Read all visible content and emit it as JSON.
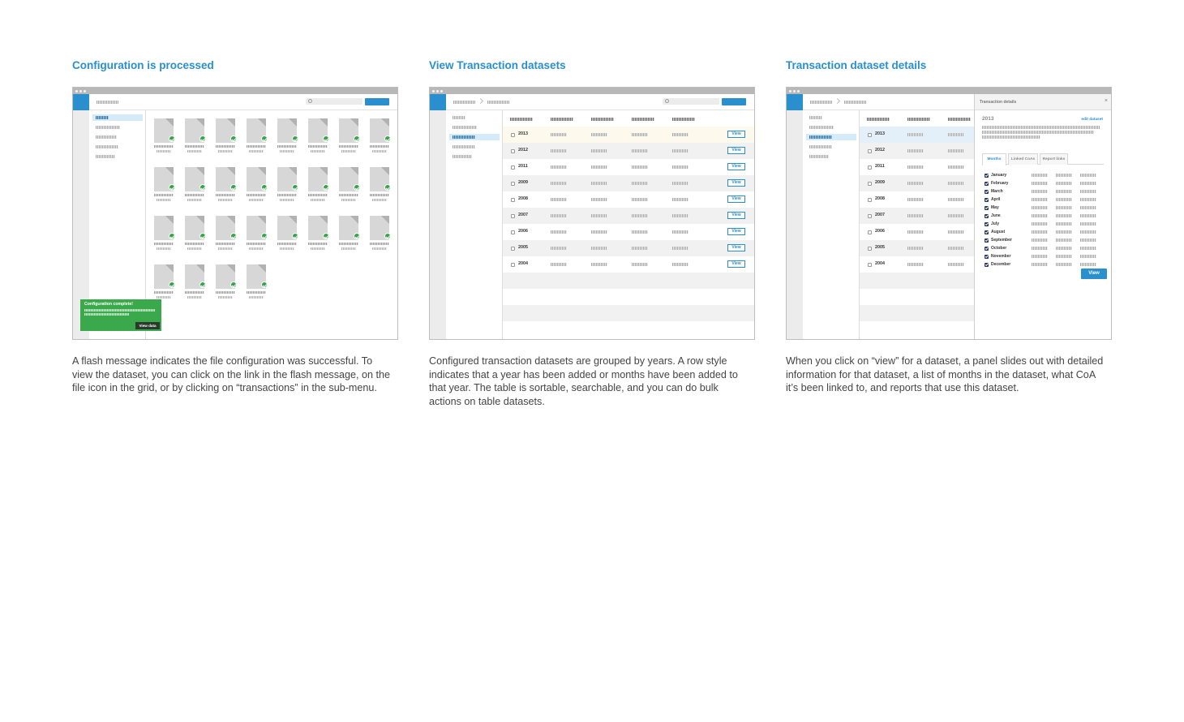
{
  "panels": [
    {
      "title": "Configuration is processed",
      "caption": "A flash message indicates the file configuration was successful. To view the dataset, you can click on the link in the flash message, on the file icon in the grid, or by clicking on “transactions” in the sub-menu.",
      "flash": {
        "title": "Configuration complete!",
        "button": "View data"
      }
    },
    {
      "title": "View Transaction datasets",
      "caption": "Configured transaction datasets are grouped by years. A row style indicates that a year has been added or months have been added to that year. The table is sortable, searchable, and you can do bulk actions on table datasets.",
      "years": [
        "2013",
        "2012",
        "2011",
        "2009",
        "2008",
        "2007",
        "2006",
        "2005",
        "2004"
      ],
      "view_label": "View"
    },
    {
      "title": "Transaction dataset details",
      "caption": "When you click on “view” for a dataset, a panel slides out with detailed information for that dataset, a list of months in the dataset, what CoA it’s been linked to, and reports that use this dataset.",
      "years": [
        "2013",
        "2012",
        "2011",
        "2009",
        "2008",
        "2007",
        "2006",
        "2005",
        "2004"
      ],
      "drawer": {
        "title": "Transaction details",
        "close": "×",
        "year": "2013",
        "edit": "edit dataset",
        "tabs": [
          "Months",
          "Linked CoAs",
          "Report links"
        ],
        "months": [
          "January",
          "February",
          "March",
          "April",
          "May",
          "June",
          "July",
          "August",
          "September",
          "October",
          "November",
          "December"
        ],
        "view_button": "View"
      }
    }
  ]
}
